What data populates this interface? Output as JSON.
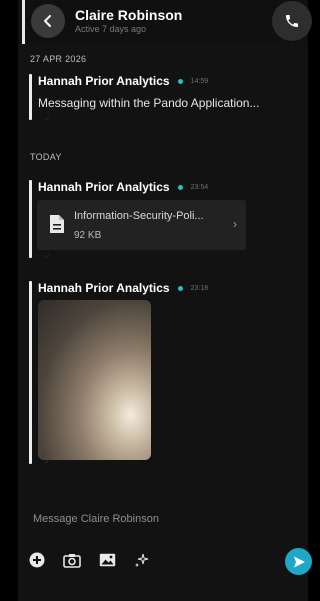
{
  "header": {
    "contact_name": "Claire Robinson",
    "status": "Active 7 days ago",
    "back_icon": "chevron-left-icon",
    "call_icon": "phone-icon"
  },
  "separators": {
    "first": "27 APR 2026",
    "today": "TODAY"
  },
  "messages": [
    {
      "sender": "Hannah Prior Analytics",
      "time": "14:59",
      "text": "Messaging within the Pando Application..."
    },
    {
      "sender": "Hannah Prior Analytics",
      "time": "23:54",
      "attachment": {
        "name": "Information-Security-Poli...",
        "size": "92 KB",
        "icon": "document-icon"
      }
    },
    {
      "sender": "Hannah Prior Analytics",
      "time": "23:18",
      "image_icon": "photo-thumbnail"
    }
  ],
  "composer": {
    "placeholder": "Message Claire Robinson",
    "icons": [
      "plus-circle-icon",
      "camera-icon",
      "image-icon",
      "sparkle-icon",
      "send-icon"
    ]
  },
  "colors": {
    "accent": "#1fa7c7",
    "online_dot": "#22c4c4",
    "background": "#000000",
    "panel": "#121212"
  }
}
